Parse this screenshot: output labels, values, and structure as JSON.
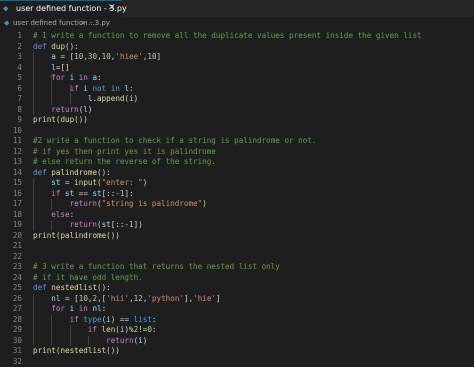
{
  "tab": {
    "title": "user defined function - 3.py",
    "close_glyph": "✕",
    "icon": "python-file-icon"
  },
  "breadcrumb": {
    "file": "user defined function - 3.py",
    "separator": ">",
    "more": "..."
  },
  "colors": {
    "background": "#1e1e1e",
    "comment": "#6a9955",
    "keyword": "#569cd6",
    "control": "#c586c0",
    "function": "#dcdcaa",
    "variable": "#9cdcfe",
    "number": "#b5cea8",
    "string": "#ce9178"
  },
  "lines": [
    {
      "n": "1",
      "t": [
        [
          "cmt",
          "# 1 write a function to remove all the duplicate values present inside the given list"
        ]
      ]
    },
    {
      "n": "2",
      "t": [
        [
          "kw",
          "def "
        ],
        [
          "fn",
          "dup"
        ],
        [
          "pun",
          "():"
        ]
      ]
    },
    {
      "n": "3",
      "t": [
        [
          "pun",
          "    "
        ],
        [
          "var",
          "a"
        ],
        [
          "pun",
          " = ["
        ],
        [
          "num",
          "10"
        ],
        [
          "pun",
          ","
        ],
        [
          "num",
          "30"
        ],
        [
          "pun",
          ","
        ],
        [
          "num",
          "10"
        ],
        [
          "pun",
          ","
        ],
        [
          "str",
          "'hiee'"
        ],
        [
          "pun",
          ","
        ],
        [
          "num",
          "10"
        ],
        [
          "pun",
          "]"
        ]
      ]
    },
    {
      "n": "4",
      "t": [
        [
          "pun",
          "    "
        ],
        [
          "var",
          "l"
        ],
        [
          "pun",
          "=[]"
        ]
      ]
    },
    {
      "n": "5",
      "t": [
        [
          "ctl",
          "    for "
        ],
        [
          "var",
          "i"
        ],
        [
          "ctl",
          " in "
        ],
        [
          "var",
          "a"
        ],
        [
          "pun",
          ":"
        ]
      ]
    },
    {
      "n": "6",
      "t": [
        [
          "ctl",
          "        if "
        ],
        [
          "var",
          "i"
        ],
        [
          "kw",
          " not in "
        ],
        [
          "var",
          "l"
        ],
        [
          "pun",
          ":"
        ]
      ]
    },
    {
      "n": "7",
      "t": [
        [
          "pun",
          "            "
        ],
        [
          "var",
          "l"
        ],
        [
          "pun",
          "."
        ],
        [
          "fn",
          "append"
        ],
        [
          "pun",
          "("
        ],
        [
          "var",
          "i"
        ],
        [
          "pun",
          ")"
        ]
      ]
    },
    {
      "n": "8",
      "t": [
        [
          "ctl",
          "    return"
        ],
        [
          "pun",
          "("
        ],
        [
          "var",
          "l"
        ],
        [
          "pun",
          ")"
        ]
      ]
    },
    {
      "n": "9",
      "t": [
        [
          "fn",
          "print"
        ],
        [
          "pun",
          "("
        ],
        [
          "fn",
          "dup"
        ],
        [
          "pun",
          "())"
        ]
      ]
    },
    {
      "n": "10",
      "t": []
    },
    {
      "n": "11",
      "t": [
        [
          "cmt",
          "#2 write a function to check if a string is palindrome or not."
        ]
      ]
    },
    {
      "n": "12",
      "t": [
        [
          "cmt",
          "# if yes then print yes it is palindrome"
        ]
      ]
    },
    {
      "n": "13",
      "t": [
        [
          "cmt",
          "# else return the reverse of the string."
        ]
      ]
    },
    {
      "n": "14",
      "t": [
        [
          "kw",
          "def "
        ],
        [
          "fn",
          "palindrome"
        ],
        [
          "pun",
          "():"
        ]
      ]
    },
    {
      "n": "15",
      "t": [
        [
          "pun",
          "    "
        ],
        [
          "var",
          "st"
        ],
        [
          "pun",
          " = "
        ],
        [
          "fn",
          "input"
        ],
        [
          "pun",
          "("
        ],
        [
          "str",
          "\"enter: \""
        ],
        [
          "pun",
          ")"
        ]
      ]
    },
    {
      "n": "16",
      "t": [
        [
          "ctl",
          "    if "
        ],
        [
          "var",
          "st"
        ],
        [
          "pun",
          " == "
        ],
        [
          "var",
          "st"
        ],
        [
          "pun",
          "[::-"
        ],
        [
          "num",
          "1"
        ],
        [
          "pun",
          "]:"
        ]
      ]
    },
    {
      "n": "17",
      "t": [
        [
          "ctl",
          "        return"
        ],
        [
          "pun",
          "("
        ],
        [
          "str",
          "\"string is palindrome\""
        ],
        [
          "pun",
          ")"
        ]
      ]
    },
    {
      "n": "18",
      "t": [
        [
          "ctl",
          "    else"
        ],
        [
          "pun",
          ":"
        ]
      ]
    },
    {
      "n": "19",
      "t": [
        [
          "ctl",
          "        return"
        ],
        [
          "pun",
          "("
        ],
        [
          "var",
          "st"
        ],
        [
          "pun",
          "[::-"
        ],
        [
          "num",
          "1"
        ],
        [
          "pun",
          "])"
        ]
      ]
    },
    {
      "n": "20",
      "t": [
        [
          "fn",
          "print"
        ],
        [
          "pun",
          "("
        ],
        [
          "fn",
          "palindrome"
        ],
        [
          "pun",
          "())"
        ]
      ]
    },
    {
      "n": "21",
      "t": []
    },
    {
      "n": "22",
      "t": []
    },
    {
      "n": "23",
      "t": [
        [
          "cmt",
          "# 3 write a function that returns the nested list only"
        ]
      ]
    },
    {
      "n": "24",
      "t": [
        [
          "cmt",
          "# if it have odd length."
        ]
      ]
    },
    {
      "n": "25",
      "t": [
        [
          "kw",
          "def "
        ],
        [
          "fn",
          "nestedlist"
        ],
        [
          "pun",
          "():"
        ]
      ]
    },
    {
      "n": "26",
      "t": [
        [
          "pun",
          "    "
        ],
        [
          "var",
          "nl"
        ],
        [
          "pun",
          " = ["
        ],
        [
          "num",
          "10"
        ],
        [
          "pun",
          ","
        ],
        [
          "num",
          "2"
        ],
        [
          "pun",
          ",["
        ],
        [
          "str",
          "'hii'"
        ],
        [
          "pun",
          ","
        ],
        [
          "num",
          "12"
        ],
        [
          "pun",
          ","
        ],
        [
          "str",
          "'python'"
        ],
        [
          "pun",
          "],"
        ],
        [
          "str",
          "'hie'"
        ],
        [
          "pun",
          "]"
        ]
      ]
    },
    {
      "n": "27",
      "t": [
        [
          "ctl",
          "    for "
        ],
        [
          "var",
          "i"
        ],
        [
          "ctl",
          " in "
        ],
        [
          "var",
          "nl"
        ],
        [
          "pun",
          ":"
        ]
      ]
    },
    {
      "n": "28",
      "t": [
        [
          "ctl",
          "        if "
        ],
        [
          "kw",
          "type"
        ],
        [
          "pun",
          "("
        ],
        [
          "var",
          "i"
        ],
        [
          "pun",
          ") == "
        ],
        [
          "kw",
          "list"
        ],
        [
          "pun",
          ":"
        ]
      ]
    },
    {
      "n": "29",
      "t": [
        [
          "ctl",
          "            if "
        ],
        [
          "fn",
          "len"
        ],
        [
          "pun",
          "("
        ],
        [
          "var",
          "i"
        ],
        [
          "pun",
          ")%"
        ],
        [
          "num",
          "2"
        ],
        [
          "pun",
          "!="
        ],
        [
          "num",
          "0"
        ],
        [
          "pun",
          ":"
        ]
      ]
    },
    {
      "n": "30",
      "t": [
        [
          "ctl",
          "                return"
        ],
        [
          "pun",
          "("
        ],
        [
          "var",
          "i"
        ],
        [
          "pun",
          ")"
        ]
      ]
    },
    {
      "n": "31",
      "t": [
        [
          "fn",
          "print"
        ],
        [
          "pun",
          "("
        ],
        [
          "fn",
          "nestedlist"
        ],
        [
          "pun",
          "())"
        ]
      ]
    },
    {
      "n": "32",
      "t": []
    }
  ]
}
